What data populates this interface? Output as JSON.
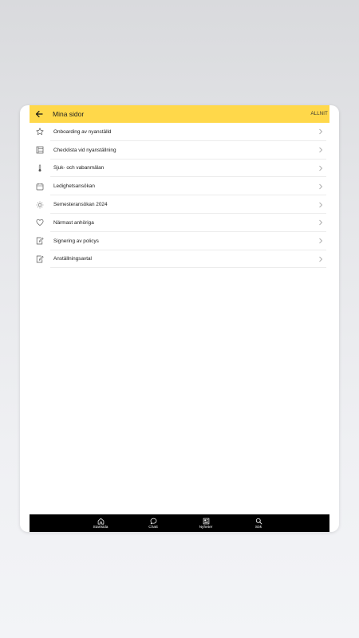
{
  "header": {
    "title": "Mina sidor",
    "action_label": "ALLNIT"
  },
  "menu_items": [
    {
      "label": "Onboarding av nyanställd",
      "icon": "star-icon"
    },
    {
      "label": "Checklista vid nyanställning",
      "icon": "checklist-icon"
    },
    {
      "label": "Sjuk- och vabanmälan",
      "icon": "thermometer-icon"
    },
    {
      "label": "Ledighetsansökan",
      "icon": "calendar-icon"
    },
    {
      "label": "Semesteransökan 2024",
      "icon": "sun-icon"
    },
    {
      "label": "Närmast anhöriga",
      "icon": "heart-icon"
    },
    {
      "label": "Signering av policys",
      "icon": "sign-document-icon"
    },
    {
      "label": "Anställningsavtal",
      "icon": "sign-document-icon"
    }
  ],
  "bottom_nav": [
    {
      "label": "Startsida",
      "icon": "home-icon"
    },
    {
      "label": "Chatt",
      "icon": "chat-icon"
    },
    {
      "label": "Nyheter",
      "icon": "news-icon"
    },
    {
      "label": "Sök",
      "icon": "search-icon"
    }
  ],
  "colors": {
    "accent": "#ffd84a",
    "bottom_bar": "#000000"
  }
}
